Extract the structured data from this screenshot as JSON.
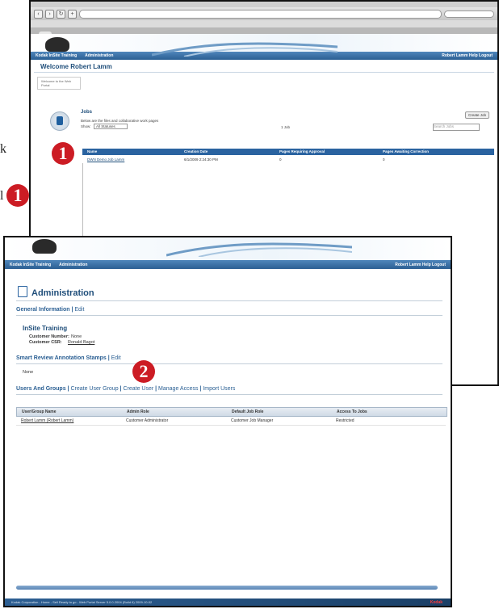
{
  "left_fragments": {
    "top": "k",
    "bottom": "l"
  },
  "callouts": {
    "one_a": "1",
    "one_b": "1",
    "two": "2"
  },
  "colors": {
    "accent_blue": "#2a63a0",
    "callout_red": "#cc1c24",
    "nav_blue": "#3c73ab"
  },
  "back_screen": {
    "nav": {
      "home_label": "Kodak InSite Training",
      "admin_label": "Administration",
      "right_links": "Robert Lamm  Help  Logout"
    },
    "welcome_title": "Welcome Robert Lamm",
    "breadcrumb": "Welcome to the Web Portal",
    "jobs": {
      "title": "Jobs",
      "description": "Below are the files and collaborative work pages",
      "show_label": "Show:",
      "show_value": "All Statuses",
      "count": "1 Job",
      "create_button": "Create Job",
      "search_placeholder": "Search Jobs",
      "columns": [
        "Name",
        "Creation Date",
        "Pages Requiring Approval",
        "Pages Awaiting Correction"
      ],
      "rows": [
        [
          "DWN Demo Job  Lamm",
          "6/1/2009 2:24:30 PM",
          "0",
          "0"
        ]
      ]
    }
  },
  "front_screen": {
    "nav": {
      "home_label": "Kodak InSite Training",
      "admin_label": "Administration",
      "right_links": "Robert Lamm  Help  Logout"
    },
    "page_title": "Administration",
    "general_info": {
      "label": "General Information",
      "edit": "Edit"
    },
    "org_name": "InSite Training",
    "customer_number_label": "Customer Number:",
    "customer_number_value": "None",
    "customer_csr_label": "Customer CSR:",
    "customer_csr_value": "Ronald Bagot",
    "smart_review": {
      "label": "Smart Review Annotation Stamps",
      "edit": "Edit",
      "value": "None"
    },
    "users_groups": {
      "label": "Users And Groups",
      "links": [
        "Create User Group",
        "Create User",
        "Manage Access",
        "Import Users"
      ],
      "columns": [
        "User/Group Name",
        "Admin Role",
        "Default Job Role",
        "Access To Jobs"
      ],
      "rows": [
        [
          "Robert Lamm (Robert Lamm)",
          "Customer Administrator",
          "Customer Job Manager",
          "Restricted"
        ]
      ]
    },
    "status_text": "Kodak Corporation - Home - Sell Ready to go - Web Portal Server 5.0.0.2004 (Build 6) 2009-10-02",
    "brand": "Kodak"
  }
}
